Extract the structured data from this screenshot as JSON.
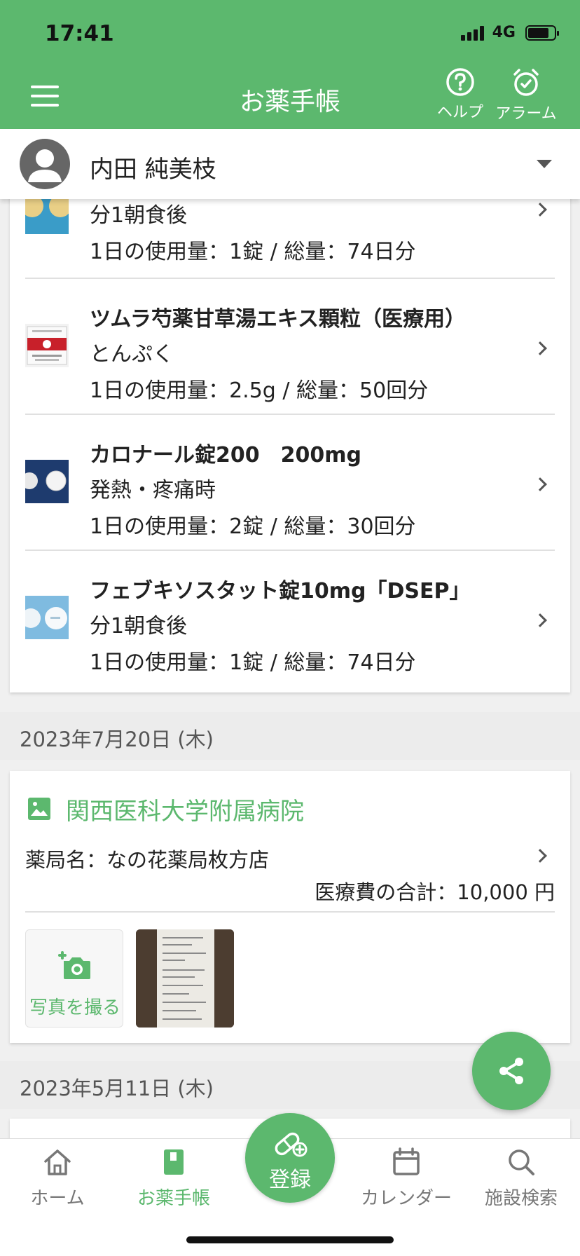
{
  "status_bar": {
    "time": "17:41",
    "network": "4G",
    "battery_level": 0.8
  },
  "header": {
    "title": "お薬手帳",
    "help_label": "ヘルプ",
    "alarm_label": "アラーム"
  },
  "profile": {
    "name": "内田 純美枝"
  },
  "medications": [
    {
      "name": "",
      "usage": "分1朝食後",
      "dose": "1日の使用量：1錠 / 総量：74日分",
      "thumb": "yellow-tablet"
    },
    {
      "name": "ツムラ芍薬甘草湯エキス顆粒（医療用）",
      "usage": "とんぷく",
      "dose": "1日の使用量：2.5g / 総量：50回分",
      "thumb": "tsumura-packet"
    },
    {
      "name": "カロナール錠200　200mg",
      "usage": "発熱・疼痛時",
      "dose": "1日の使用量：2錠 / 総量：30回分",
      "thumb": "white-tablet-blue"
    },
    {
      "name": "フェブキソスタット錠10mg「DSEP」",
      "usage": "分1朝食後",
      "dose": "1日の使用量：1錠 / 総量：74日分",
      "thumb": "white-tablet-lightblue"
    }
  ],
  "records": [
    {
      "date": "2023年7月20日 (木)",
      "hospital": "関西医科大学附属病院",
      "pharmacy": "薬局名：なの花薬局枚方店",
      "cost": "医療費の合計：10,000 円",
      "photo_button_label": "写真を撮る"
    },
    {
      "date": "2023年5月11日 (木)"
    }
  ],
  "bottom_nav": {
    "home": "ホーム",
    "notebook": "お薬手帳",
    "register": "登録",
    "calendar": "カレンダー",
    "facility_search": "施設検索"
  },
  "colors": {
    "primary": "#5cb86e",
    "text": "#222222",
    "band": "#ececec"
  }
}
